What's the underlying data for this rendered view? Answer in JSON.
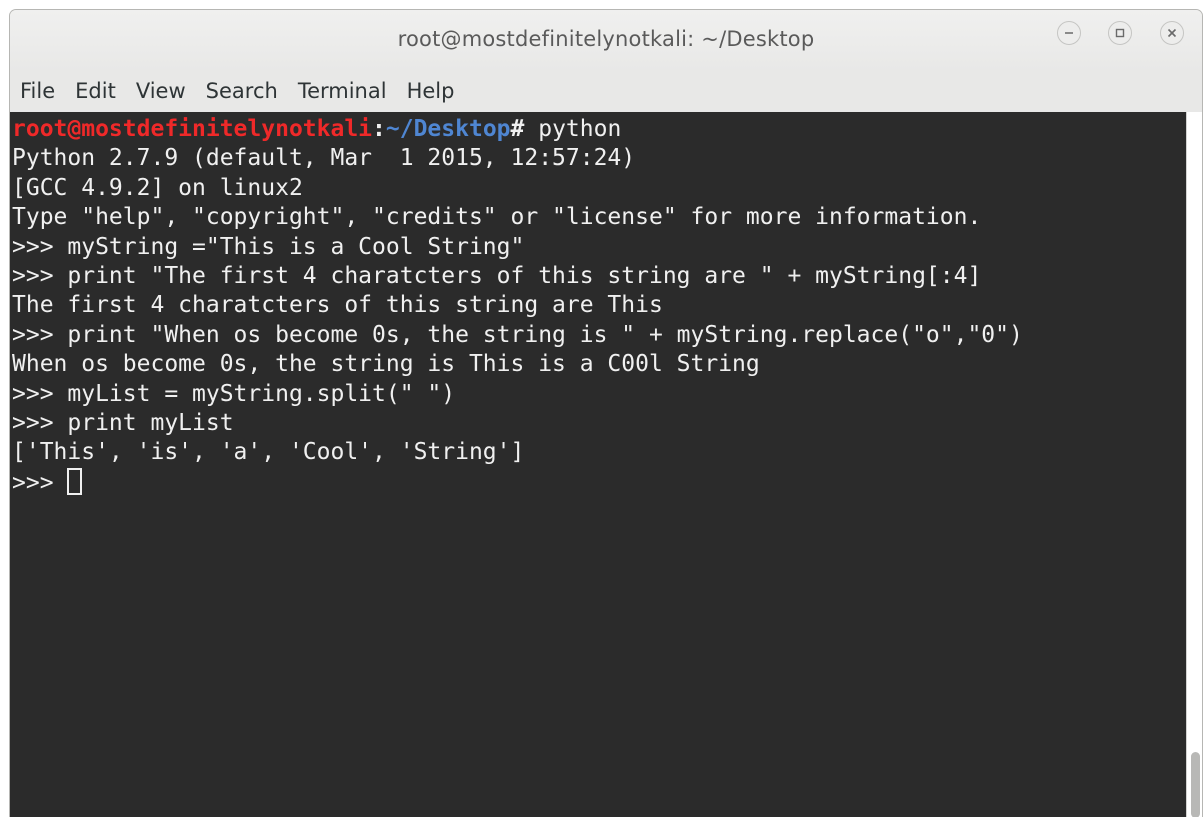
{
  "window": {
    "title": "root@mostdefinitelynotkali: ~/Desktop"
  },
  "menu": {
    "items": [
      "File",
      "Edit",
      "View",
      "Search",
      "Terminal",
      "Help"
    ]
  },
  "terminal": {
    "prompt": {
      "user_host": "root@mostdefinitelynotkali",
      "colon": ":",
      "path": "~/Desktop",
      "symbol": "#",
      "command": " python"
    },
    "lines": [
      "Python 2.7.9 (default, Mar  1 2015, 12:57:24)",
      "[GCC 4.9.2] on linux2",
      "Type \"help\", \"copyright\", \"credits\" or \"license\" for more information.",
      ">>> myString =\"This is a Cool String\"",
      ">>> print \"The first 4 charatcters of this string are \" + myString[:4]",
      "The first 4 charatcters of this string are This",
      ">>> print \"When os become 0s, the string is \" + myString.replace(\"o\",\"0\")",
      "When os become 0s, the string is This is a C00l String",
      ">>> myList = myString.split(\" \")",
      ">>> print myList",
      "['This', 'is', 'a', 'Cool', 'String']"
    ],
    "current_prompt": ">>> ",
    "colors": {
      "background": "#2b2b2b",
      "foreground": "#f0f0f0",
      "user_host": "#ef2929",
      "path": "#4f86d2"
    }
  },
  "icons": {
    "minimize": "minimize-icon",
    "maximize": "maximize-icon",
    "close": "close-icon"
  }
}
